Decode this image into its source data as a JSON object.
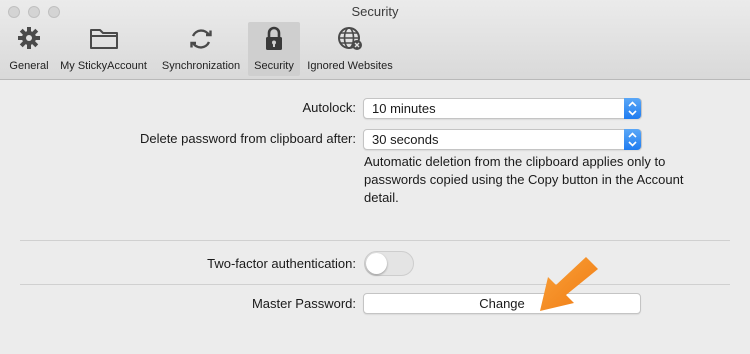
{
  "window": {
    "title": "Security"
  },
  "toolbar": {
    "items": [
      {
        "label": "General"
      },
      {
        "label": "My StickyAccount"
      },
      {
        "label": "Synchronization"
      },
      {
        "label": "Security"
      },
      {
        "label": "Ignored Websites"
      }
    ]
  },
  "settings": {
    "autolock": {
      "label": "Autolock:",
      "value": "10 minutes"
    },
    "clipboard": {
      "label": "Delete password from clipboard after:",
      "value": "30 seconds",
      "note_lines": [
        "Automatic deletion from the clipboard applies only to",
        "passwords copied using the Copy button in the Account",
        "detail."
      ]
    },
    "two_factor": {
      "label": "Two-factor authentication:",
      "state": "off"
    },
    "master_password": {
      "label": "Master Password:",
      "button": "Change"
    }
  },
  "colors": {
    "accent": "#1f7cf0",
    "arrow": "#f7941d"
  }
}
